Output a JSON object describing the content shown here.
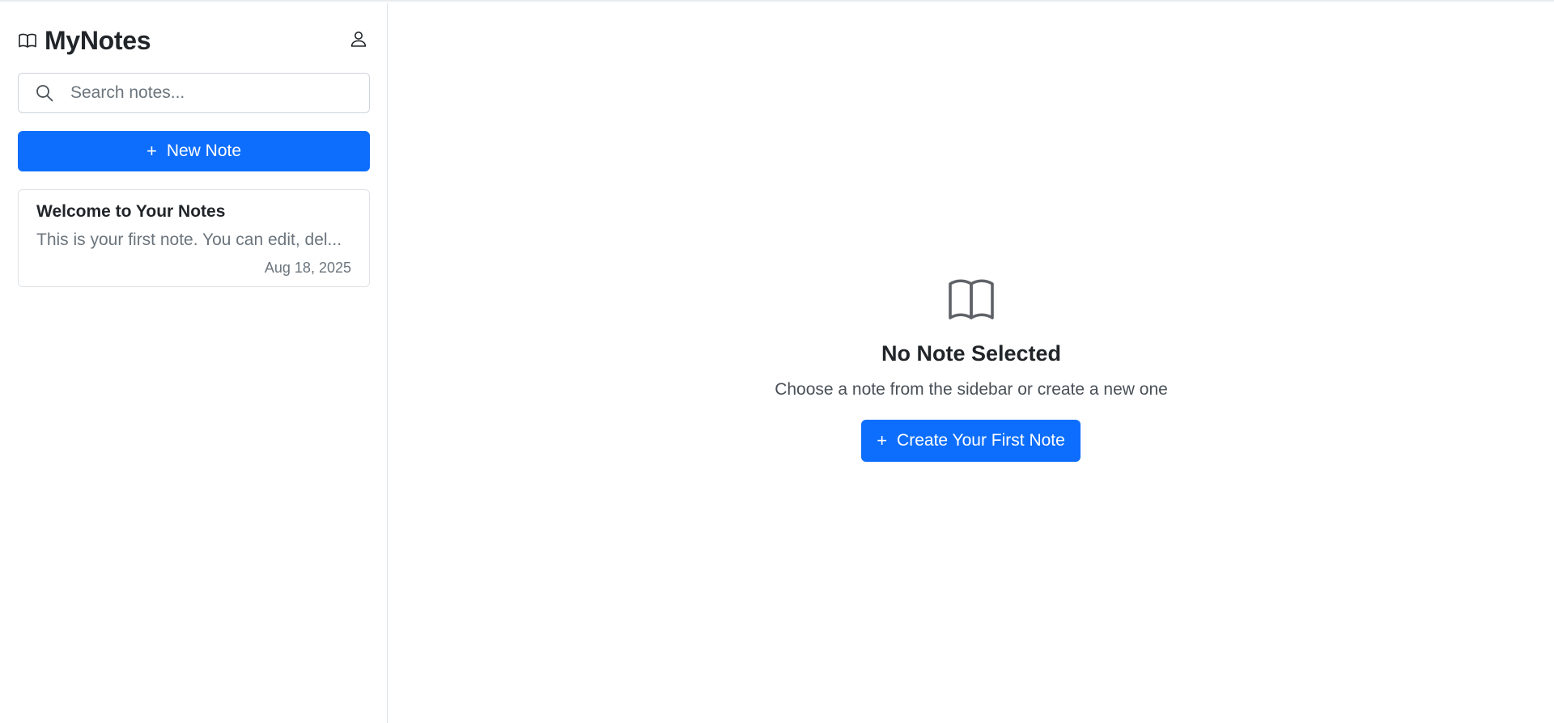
{
  "app": {
    "title": "MyNotes",
    "brand_icon": "book-icon",
    "user_icon": "person-icon",
    "accent_color": "#0d6efd"
  },
  "sidebar": {
    "search": {
      "placeholder": "Search notes...",
      "value": "",
      "icon": "search-icon"
    },
    "new_note_button": {
      "icon": "+",
      "label": "New Note"
    },
    "notes": [
      {
        "title": "Welcome to Your Notes",
        "preview": "This is your first note. You can edit, del...",
        "date": "Aug 18, 2025"
      }
    ]
  },
  "main": {
    "empty_state": {
      "icon": "open-book-icon",
      "title": "No Note Selected",
      "subtitle": "Choose a note from the sidebar or create a new one",
      "button": {
        "icon": "+",
        "label": "Create Your First Note"
      }
    }
  }
}
